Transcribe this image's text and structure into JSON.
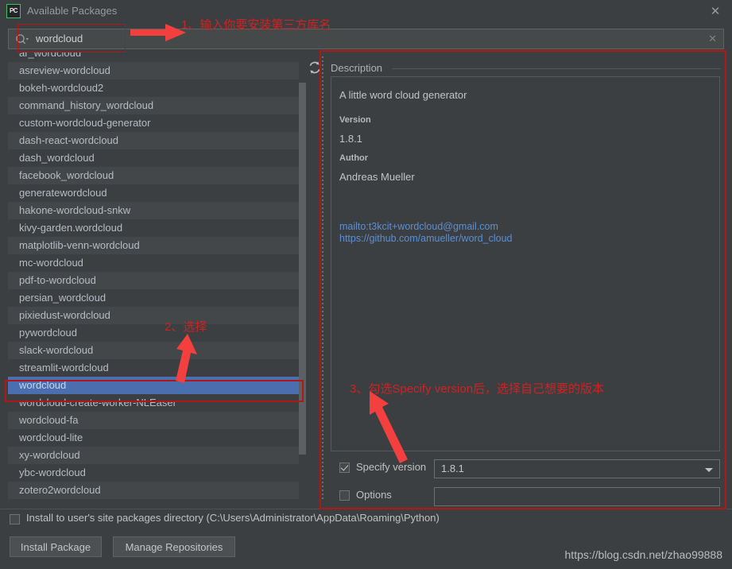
{
  "window": {
    "title": "Available Packages",
    "logo_text": "PC",
    "close_label": "✕"
  },
  "search": {
    "value": "wordcloud",
    "placeholder": "",
    "clear_label": "✕",
    "icon": "search-icon"
  },
  "toolbar": {
    "refresh_icon": "refresh-icon"
  },
  "package_list": {
    "selected": "wordcloud",
    "items": [
      "ar_wordcloud",
      "asreview-wordcloud",
      "bokeh-wordcloud2",
      "command_history_wordcloud",
      "custom-wordcloud-generator",
      "dash-react-wordcloud",
      "dash_wordcloud",
      "facebook_wordcloud",
      "generatewordcloud",
      "hakone-wordcloud-snkw",
      "kivy-garden.wordcloud",
      "matplotlib-venn-wordcloud",
      "mc-wordcloud",
      "pdf-to-wordcloud",
      "persian_wordcloud",
      "pixiedust-wordcloud",
      "pywordcloud",
      "slack-wordcloud",
      "streamlit-wordcloud",
      "wordcloud",
      "wordcloud-create-worker-NLEaser",
      "wordcloud-fa",
      "wordcloud-lite",
      "xy-wordcloud",
      "ybc-wordcloud",
      "zotero2wordcloud"
    ]
  },
  "description": {
    "legend": "Description",
    "summary": "A little word cloud generator",
    "version_label": "Version",
    "version_value": "1.8.1",
    "author_label": "Author",
    "author_value": "Andreas Mueller",
    "links": [
      "mailto:t3kcit+wordcloud@gmail.com",
      "https://github.com/amueller/word_cloud"
    ]
  },
  "options": {
    "specify_version_label": "Specify version",
    "specify_version_checked": true,
    "version_selected": "1.8.1",
    "options_label": "Options",
    "options_checked": false,
    "options_value": ""
  },
  "footer": {
    "user_site_label": "Install to user's site packages directory (C:\\Users\\Administrator\\AppData\\Roaming\\Python)",
    "user_site_checked": false,
    "install_button": "Install Package",
    "manage_button": "Manage Repositories",
    "watermark": "https://blog.csdn.net/zhao99888"
  },
  "annotations": {
    "accent_color": "#cf2222",
    "box_color": "#b01818",
    "arrow_color": "#f43f3f",
    "step1": "1、输入你要安装第三方库名",
    "step2": "2、选择",
    "step3": "3、勾选Specify version后，选择自己想要的版本"
  }
}
